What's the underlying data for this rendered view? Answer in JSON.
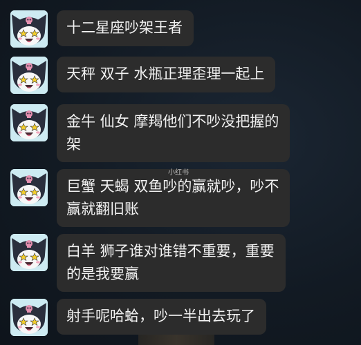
{
  "watermark": "小红书",
  "messages": [
    {
      "lines": [
        "十二星座吵架王者"
      ]
    },
    {
      "lines": [
        "天秤 双子 水瓶正理歪理一起上"
      ]
    },
    {
      "lines": [
        "金牛 仙女 摩羯他们不吵没把握的",
        "架"
      ]
    },
    {
      "lines": [
        "巨蟹 天蝎 双鱼吵的赢就吵，吵不",
        "赢就翻旧账"
      ]
    },
    {
      "lines": [
        "白羊 狮子谁对谁错不重要，重要",
        "的是我要赢"
      ]
    },
    {
      "lines": [
        "射手呢哈蛤，吵一半出去玩了"
      ]
    }
  ],
  "avatar_icon": "kuromi-avatar-icon",
  "colors": {
    "bubble": "#2c2c2c",
    "text": "#f2f2f2",
    "avatar_bg": "#cdebf2"
  }
}
